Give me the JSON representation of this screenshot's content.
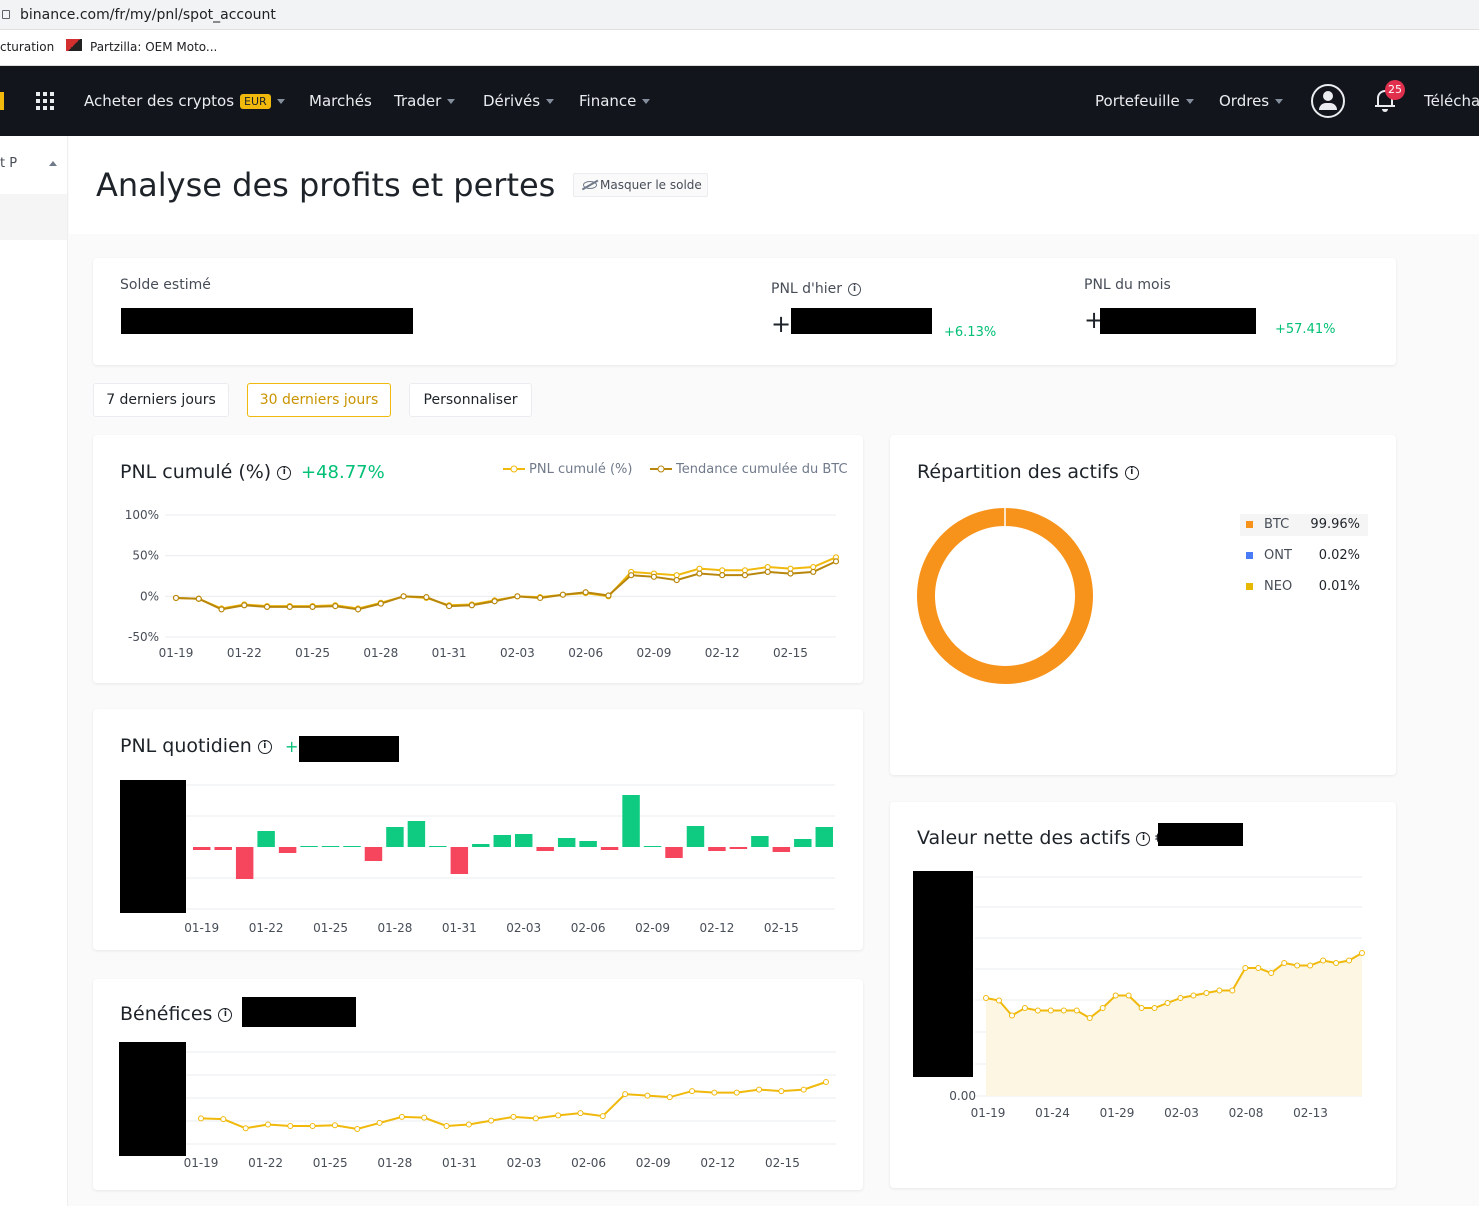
{
  "browser": {
    "url": "binance.com/fr/my/pnl/spot_account",
    "bookmarks": [
      "cturation",
      "Partzilla: OEM Moto..."
    ]
  },
  "nav": {
    "buy_crypto": "Acheter des cryptos",
    "currency_badge": "EUR",
    "markets": "Marchés",
    "trade": "Trader",
    "derivatives": "Dérivés",
    "finance": "Finance",
    "wallet": "Portefeuille",
    "orders": "Ordres",
    "notifications_count": "25",
    "download": "Télécha",
    "icons": [
      "grid-menu-icon",
      "user-icon",
      "bell-icon"
    ]
  },
  "sidebar": {
    "label": "t P"
  },
  "page": {
    "title": "Analyse des profits et pertes",
    "hide_balance": "Masquer le solde"
  },
  "summary": {
    "estimated_balance_label": "Solde estimé",
    "yesterday_pnl_label": "PNL d'hier",
    "yesterday_pnl_sign": "+",
    "yesterday_pnl_pct": "+6.13%",
    "month_pnl_label": "PNL du mois",
    "month_pnl_sign": "+",
    "month_pnl_pct": "+57.41%"
  },
  "periods": {
    "p7": "7 derniers jours",
    "p30": "30 derniers jours",
    "custom": "Personnaliser",
    "active": "30 derniers jours"
  },
  "colors": {
    "accent": "#f0b90b",
    "btc_trend": "#b8860b",
    "positive": "#0ecb81",
    "negative": "#f6465d",
    "btc": "#f7931a",
    "ont": "#4a7bf7",
    "neo": "#e6b800"
  },
  "cards": {
    "cumulative_pnl": {
      "title": "PNL cumulé (%)",
      "value": "+48.77%"
    },
    "daily_pnl": {
      "title": "PNL quotidien",
      "value_prefix": "+"
    },
    "profits": {
      "title": "Bénéfices"
    },
    "allocation": {
      "title": "Répartition des actifs"
    },
    "net_worth": {
      "title": "Valeur nette des actifs",
      "value_prefix": "€"
    }
  },
  "chart_data": [
    {
      "id": "cumulative",
      "type": "line",
      "title": "PNL cumulé (%)",
      "x_ticks": [
        "01-19",
        "01-22",
        "01-25",
        "01-28",
        "01-31",
        "02-03",
        "02-06",
        "02-09",
        "02-12",
        "02-15"
      ],
      "y_ticks": [
        "100%",
        "50%",
        "0%",
        "-50%"
      ],
      "ylim": [
        -50,
        100
      ],
      "series": [
        {
          "name": "PNL cumulé (%)",
          "values": [
            -2,
            -3,
            -15,
            -10,
            -12,
            -12,
            -12,
            -11,
            -15,
            -8,
            0,
            -2,
            -11,
            -10,
            -5,
            0,
            -1,
            2,
            4,
            0,
            30,
            28,
            26,
            34,
            32,
            32,
            36,
            34,
            36,
            48
          ]
        },
        {
          "name": "Tendance cumulée du BTC",
          "values": [
            -2,
            -3,
            -16,
            -11,
            -13,
            -13,
            -13,
            -12,
            -16,
            -9,
            0,
            -1,
            -12,
            -11,
            -6,
            0,
            -2,
            2,
            5,
            1,
            26,
            24,
            20,
            28,
            26,
            26,
            30,
            28,
            30,
            43
          ]
        }
      ],
      "legend": "top-right"
    },
    {
      "id": "daily",
      "type": "bar",
      "title": "PNL quotidien",
      "x_ticks": [
        "01-19",
        "01-22",
        "01-25",
        "01-28",
        "01-31",
        "02-03",
        "02-06",
        "02-09",
        "02-12",
        "02-15"
      ],
      "values": [
        -3,
        -3,
        -32,
        16,
        -6,
        1,
        0,
        1,
        -14,
        20,
        26,
        0,
        -27,
        3,
        12,
        13,
        -4,
        9,
        6,
        -3,
        52,
        0,
        -11,
        21,
        -4,
        -2,
        11,
        -5,
        8,
        20
      ]
    },
    {
      "id": "profits",
      "type": "line",
      "title": "Bénéfices",
      "x_ticks": [
        "01-19",
        "01-22",
        "01-25",
        "01-28",
        "01-31",
        "02-03",
        "02-06",
        "02-09",
        "02-12",
        "02-15"
      ],
      "values": [
        -2,
        -3,
        -15,
        -10,
        -12,
        -12,
        -11,
        -16,
        -8,
        0,
        -1,
        -12,
        -10,
        -5,
        0,
        -2,
        2,
        5,
        1,
        30,
        28,
        26,
        34,
        32,
        32,
        36,
        34,
        36,
        46
      ]
    },
    {
      "id": "networth",
      "type": "area",
      "title": "Valeur nette des actifs",
      "x_ticks": [
        "01-19",
        "01-24",
        "01-29",
        "02-03",
        "02-08",
        "02-13"
      ],
      "y_ticks": [
        "0.00"
      ],
      "values": [
        40,
        39,
        33,
        36,
        35,
        35,
        35,
        35,
        32,
        36,
        41,
        41,
        36,
        36,
        38,
        40,
        41,
        42,
        43,
        43,
        52,
        52,
        50,
        54,
        53,
        53,
        55,
        54,
        55,
        58
      ]
    },
    {
      "id": "allocation",
      "type": "pie",
      "title": "Répartition des actifs",
      "categories": [
        "BTC",
        "ONT",
        "NEO"
      ],
      "values": [
        99.96,
        0.02,
        0.01
      ],
      "labels": [
        "99.96%",
        "0.02%",
        "0.01%"
      ]
    }
  ]
}
